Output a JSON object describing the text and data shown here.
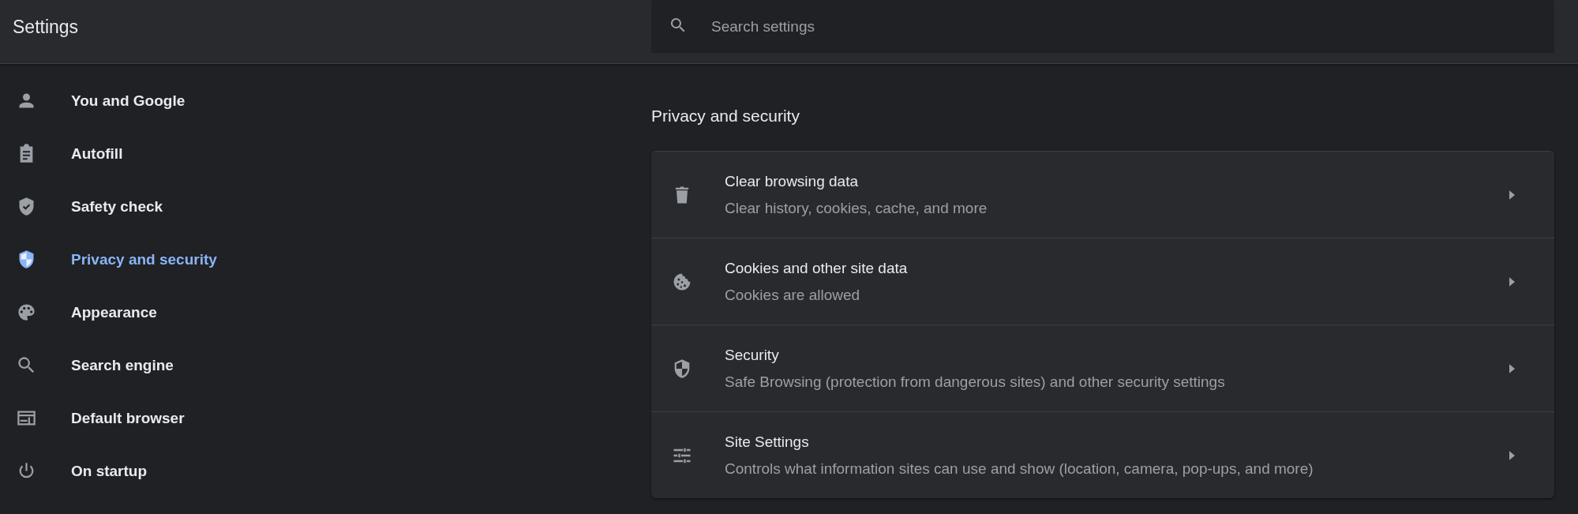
{
  "header": {
    "title": "Settings",
    "search": {
      "placeholder": "Search settings"
    }
  },
  "sidebar": {
    "items": [
      {
        "label": "You and Google",
        "selected": false
      },
      {
        "label": "Autofill",
        "selected": false
      },
      {
        "label": "Safety check",
        "selected": false
      },
      {
        "label": "Privacy and security",
        "selected": true
      },
      {
        "label": "Appearance",
        "selected": false
      },
      {
        "label": "Search engine",
        "selected": false
      },
      {
        "label": "Default browser",
        "selected": false
      },
      {
        "label": "On startup",
        "selected": false
      }
    ]
  },
  "section": {
    "title": "Privacy and security",
    "rows": [
      {
        "title": "Clear browsing data",
        "subtitle": "Clear history, cookies, cache, and more"
      },
      {
        "title": "Cookies and other site data",
        "subtitle": "Cookies are allowed"
      },
      {
        "title": "Security",
        "subtitle": "Safe Browsing (protection from dangerous sites) and other security settings"
      },
      {
        "title": "Site Settings",
        "subtitle": "Controls what information sites can use and show (location, camera, pop-ups, and more)"
      }
    ]
  }
}
